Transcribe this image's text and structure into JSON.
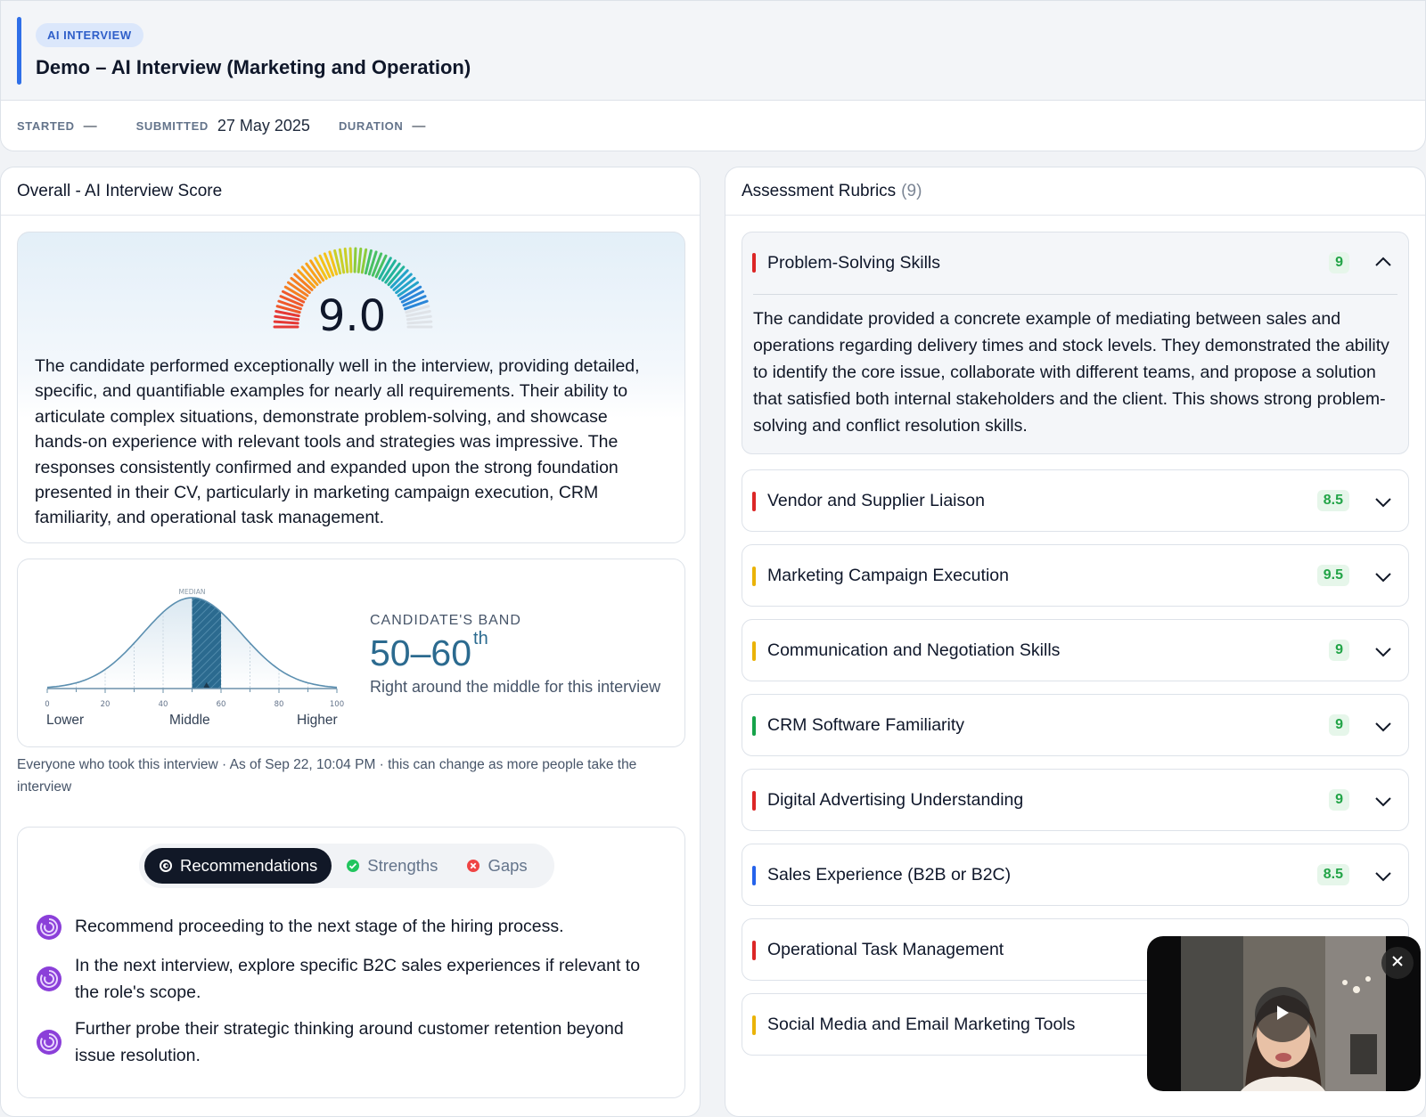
{
  "header": {
    "badge": "AI INTERVIEW",
    "title": "Demo – AI Interview (Marketing and Operation)",
    "started_label": "STARTED",
    "started_value": "—",
    "submitted_label": "SUBMITTED",
    "submitted_value": "27 May 2025",
    "duration_label": "DURATION",
    "duration_value": "—"
  },
  "overall": {
    "title": "Overall - AI Interview Score",
    "score": "9.0",
    "score_fraction": 0.9,
    "summary": "The candidate performed exceptionally well in the interview, providing detailed, specific, and quantifiable examples for nearly all requirements. Their ability to articulate complex situations, demonstrate problem-solving, and showcase hands-on experience with relevant tools and strategies was impressive. The responses consistently confirmed and expanded upon the strong foundation presented in their CV, particularly in marketing campaign execution, CRM familiarity, and operational task management."
  },
  "band": {
    "median_label": "MEDIAN",
    "ticks": [
      "0",
      "20",
      "40",
      "60",
      "80",
      "100"
    ],
    "band_range": [
      50,
      60
    ],
    "label": "CANDIDATE'S BAND",
    "value": "50–60",
    "suffix": "th",
    "description": "Right around the middle for this interview",
    "lower": "Lower",
    "middle": "Middle",
    "higher": "Higher"
  },
  "note": "Everyone who took this interview · As of Sep 22, 10:04 PM · this can change as more people take the interview",
  "tabs": [
    {
      "label": "Recommendations",
      "icon": "recommendations-icon",
      "active": true
    },
    {
      "label": "Strengths",
      "icon": "check-circle-icon",
      "active": false
    },
    {
      "label": "Gaps",
      "icon": "x-circle-icon",
      "active": false
    }
  ],
  "recommendations": [
    "Recommend proceeding to the next stage of the hiring process.",
    "In the next interview, explore specific B2C sales experiences if relevant to the role's scope.",
    "Further probe their strategic thinking around customer retention beyond issue resolution."
  ],
  "rubrics": {
    "title": "Assessment Rubrics",
    "count": "(9)",
    "items": [
      {
        "name": "Problem-Solving Skills",
        "score": "9",
        "color": "#dc2626",
        "expanded": true,
        "body": "The candidate provided a concrete example of mediating between sales and operations regarding delivery times and stock levels. They demonstrated the ability to identify the core issue, collaborate with different teams, and propose a solution that satisfied both internal stakeholders and the client. This shows strong problem-solving and conflict resolution skills."
      },
      {
        "name": "Vendor and Supplier Liaison",
        "score": "8.5",
        "color": "#dc2626"
      },
      {
        "name": "Marketing Campaign Execution",
        "score": "9.5",
        "color": "#eab308"
      },
      {
        "name": "Communication and Negotiation Skills",
        "score": "9",
        "color": "#eab308"
      },
      {
        "name": "CRM Software Familiarity",
        "score": "9",
        "color": "#16a34a"
      },
      {
        "name": "Digital Advertising Understanding",
        "score": "9",
        "color": "#dc2626"
      },
      {
        "name": "Sales Experience (B2B or B2C)",
        "score": "8.5",
        "color": "#2563eb"
      },
      {
        "name": "Operational Task Management",
        "score": "",
        "color": "#dc2626"
      },
      {
        "name": "Social Media and Email Marketing Tools",
        "score": "",
        "color": "#eab308"
      }
    ]
  },
  "video": {
    "close_icon": "close-icon",
    "play_icon": "play-icon"
  }
}
